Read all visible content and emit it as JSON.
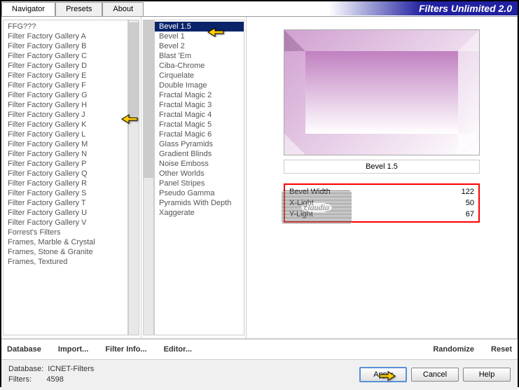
{
  "title": "Filters Unlimited 2.0",
  "tabs": [
    {
      "label": "Navigator",
      "active": true
    },
    {
      "label": "Presets",
      "active": false
    },
    {
      "label": "About",
      "active": false
    }
  ],
  "categories": [
    "FFG???",
    "Filter Factory Gallery A",
    "Filter Factory Gallery B",
    "Filter Factory Gallery C",
    "Filter Factory Gallery D",
    "Filter Factory Gallery E",
    "Filter Factory Gallery F",
    "Filter Factory Gallery G",
    "Filter Factory Gallery H",
    "Filter Factory Gallery J",
    "Filter Factory Gallery K",
    "Filter Factory Gallery L",
    "Filter Factory Gallery M",
    "Filter Factory Gallery N",
    "Filter Factory Gallery P",
    "Filter Factory Gallery Q",
    "Filter Factory Gallery R",
    "Filter Factory Gallery S",
    "Filter Factory Gallery T",
    "Filter Factory Gallery U",
    "Filter Factory Gallery V",
    "Forrest's Filters",
    "Frames, Marble & Crystal",
    "Frames, Stone & Granite",
    "Frames, Textured"
  ],
  "filters": [
    "Bevel 1.5",
    "Bevel 1",
    "Bevel 2",
    "Blast 'Em",
    "Ciba-Chrome",
    "Cirquelate",
    "Double Image",
    "Fractal Magic 2",
    "Fractal Magic 3",
    "Fractal Magic 4",
    "Fractal Magic 5",
    "Fractal Magic 6",
    "Glass Pyramids",
    "Gradient Blinds",
    "Noise Emboss",
    "Other Worlds",
    "Panel Stripes",
    "Pseudo Gamma",
    "Pyramids With Depth",
    "Xaggerate"
  ],
  "selected_filter": "Bevel 1.5",
  "filter_label": "Bevel 1.5",
  "params": [
    {
      "label": "Bevel Width",
      "value": "122"
    },
    {
      "label": "X-Light",
      "value": "50"
    },
    {
      "label": "Y-Light",
      "value": "67"
    }
  ],
  "buttons": {
    "database": "Database",
    "import": "Import...",
    "filter_info": "Filter Info...",
    "editor": "Editor...",
    "randomize": "Randomize",
    "reset": "Reset",
    "apply": "Apply",
    "cancel": "Cancel",
    "help": "Help"
  },
  "footer": {
    "db_label": "Database:",
    "db_value": "ICNET-Filters",
    "filters_label": "Filters:",
    "filters_value": "4598"
  },
  "watermark": "claudia"
}
